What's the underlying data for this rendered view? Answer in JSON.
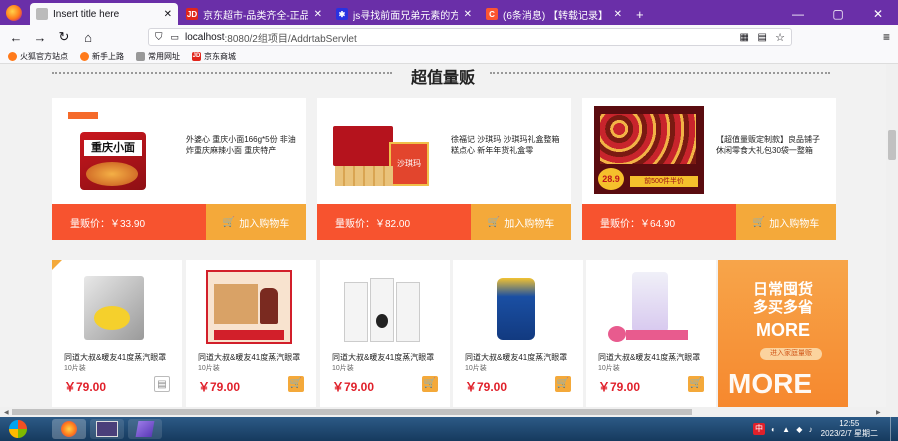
{
  "browser": {
    "tabs": [
      {
        "title": "Insert title here",
        "active": true,
        "favicon": "page-icon"
      },
      {
        "title": "京东超市-品类齐全-正品行货-",
        "active": false,
        "favicon": "JD"
      },
      {
        "title": "js寻找前面兄弟元素的方法_百度",
        "active": false,
        "favicon": "paw"
      },
      {
        "title": "(6条消息) 【转载记录】JS/JQu",
        "active": false,
        "favicon": "C"
      }
    ],
    "new_tab": "+",
    "url_host": "localhost",
    "url_path": ":8080/2组项目/AddrtabServlet",
    "bookmarks": [
      {
        "label": "火狐官方站点",
        "icon": "firefox-icon"
      },
      {
        "label": "新手上路",
        "icon": "firefox-icon"
      },
      {
        "label": "常用网址",
        "icon": "folder-icon"
      },
      {
        "label": "京东商城",
        "icon": "JD"
      }
    ],
    "colors": {
      "tabbar": "#6a2fa8",
      "accent_red": "#f7532f",
      "accent_orange": "#f4a93a"
    }
  },
  "section": {
    "title": "超值量贩"
  },
  "featured": [
    {
      "name": "外婆心 重庆小面166g*5份 非油炸重庆麻辣小面 重庆特产",
      "price_label": "量贩价：￥33.90",
      "cart_label": "加入购物车",
      "img_text": "重庆小面"
    },
    {
      "name": "徐福记 沙琪玛 沙琪玛礼盒整箱糕点心 新年年货礼盒零",
      "price_label": "量贩价：￥82.00",
      "cart_label": "加入购物车",
      "img_text": "沙琪玛"
    },
    {
      "name": "【超值量贩定制款】良品铺子 休闲零食大礼包30袋一整箱",
      "price_label": "量贩价：￥64.90",
      "cart_label": "加入购物车",
      "img_text": "28.9",
      "img_text2": "前500件半价"
    }
  ],
  "products": [
    {
      "name": "同道大叔&暖友41度蒸汽眼罩",
      "sub": "10片装",
      "price": "￥79.00"
    },
    {
      "name": "同道大叔&暖友41度蒸汽眼罩",
      "sub": "10片装",
      "price": "￥79.00"
    },
    {
      "name": "同道大叔&暖友41度蒸汽眼罩",
      "sub": "10片装",
      "price": "￥79.00"
    },
    {
      "name": "同道大叔&暖友41度蒸汽眼罩",
      "sub": "10片装",
      "price": "￥79.00"
    },
    {
      "name": "同道大叔&暖友41度蒸汽眼罩",
      "sub": "10片装",
      "price": "￥79.00"
    }
  ],
  "promo": {
    "line1": "日常囤货",
    "line2": "多买多省",
    "more": "MORE",
    "button": "进入家庭量贩",
    "big_more": "MORE"
  },
  "taskbar": {
    "time": "12:55",
    "date": "2023/2/7 星期二",
    "ime": "中"
  }
}
